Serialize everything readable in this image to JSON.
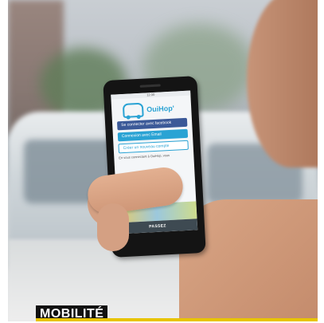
{
  "photo": {
    "subject": "hand holding smartphone showing OuiHop' app"
  },
  "app": {
    "brand": "OuiHop'",
    "status_time": "12:30",
    "buttons": [
      {
        "label": "Se connecter avec facebook"
      },
      {
        "label": "Connexion avec Email"
      },
      {
        "label": "Créer un nouveau compte"
      }
    ],
    "legal_text": "En vous connectant à OuiHop, vous",
    "footer_label": "PASSEZ"
  },
  "caption": {
    "tag": "MOBILITÉ"
  },
  "colors": {
    "brand_blue": "#2aa3d4",
    "facebook_blue": "#3b5998",
    "tag_bg": "#111111",
    "tag_accent": "#e8c400"
  }
}
